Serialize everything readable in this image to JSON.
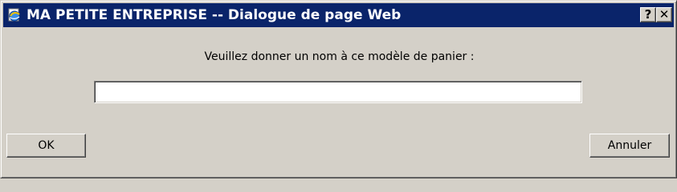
{
  "window": {
    "title": "MA PETITE ENTREPRISE -- Dialogue de page Web",
    "title_icon": "ie-page-icon",
    "help_label": "?",
    "close_label": "✕",
    "colors": {
      "titlebar": "#0a246a",
      "face": "#d4d0c8"
    }
  },
  "dialog": {
    "prompt": "Veuillez donner un nom à ce modèle de panier :",
    "name_value": "",
    "ok_label": "OK",
    "cancel_label": "Annuler"
  }
}
